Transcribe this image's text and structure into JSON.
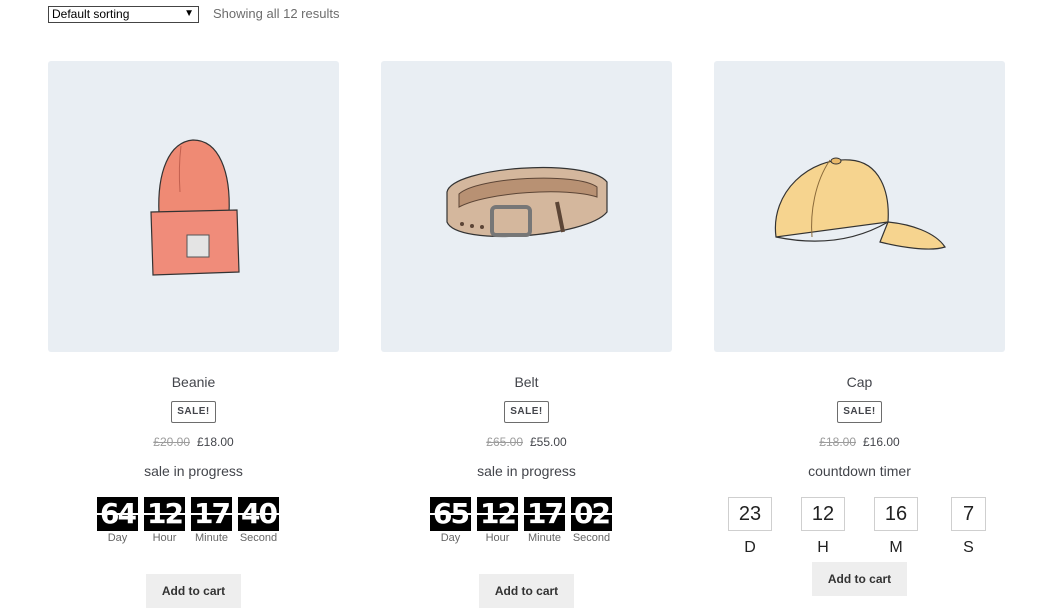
{
  "toolbar": {
    "sort_value": "Default sorting",
    "result_count": "Showing all 12 results"
  },
  "products": [
    {
      "name": "Beanie",
      "badge": "SALE!",
      "old_price": "£20.00",
      "new_price": "£18.00",
      "status": "sale in progress",
      "countdown": {
        "day": "64",
        "hour": "12",
        "minute": "17",
        "second": "40"
      },
      "countdown_labels": {
        "day": "Day",
        "hour": "Hour",
        "minute": "Minute",
        "second": "Second"
      },
      "button": "Add to cart",
      "image_icon": "beanie-hat-icon",
      "image_color": "#ef8a74"
    },
    {
      "name": "Belt",
      "badge": "SALE!",
      "old_price": "£65.00",
      "new_price": "£55.00",
      "status": "sale in progress",
      "countdown": {
        "day": "65",
        "hour": "12",
        "minute": "17",
        "second": "02"
      },
      "countdown_labels": {
        "day": "Day",
        "hour": "Hour",
        "minute": "Minute",
        "second": "Second"
      },
      "button": "Add to cart",
      "image_icon": "belt-icon",
      "image_color": "#c9a98c"
    },
    {
      "name": "Cap",
      "badge": "SALE!",
      "old_price": "£18.00",
      "new_price": "£16.00",
      "status": "countdown timer",
      "countdown": {
        "d": "23",
        "h": "12",
        "m": "16",
        "s": "7"
      },
      "countdown_labels": {
        "d": "D",
        "h": "H",
        "m": "M",
        "s": "S"
      },
      "button": "Add to cart",
      "image_icon": "baseball-cap-icon",
      "image_color": "#f6d48f"
    }
  ]
}
